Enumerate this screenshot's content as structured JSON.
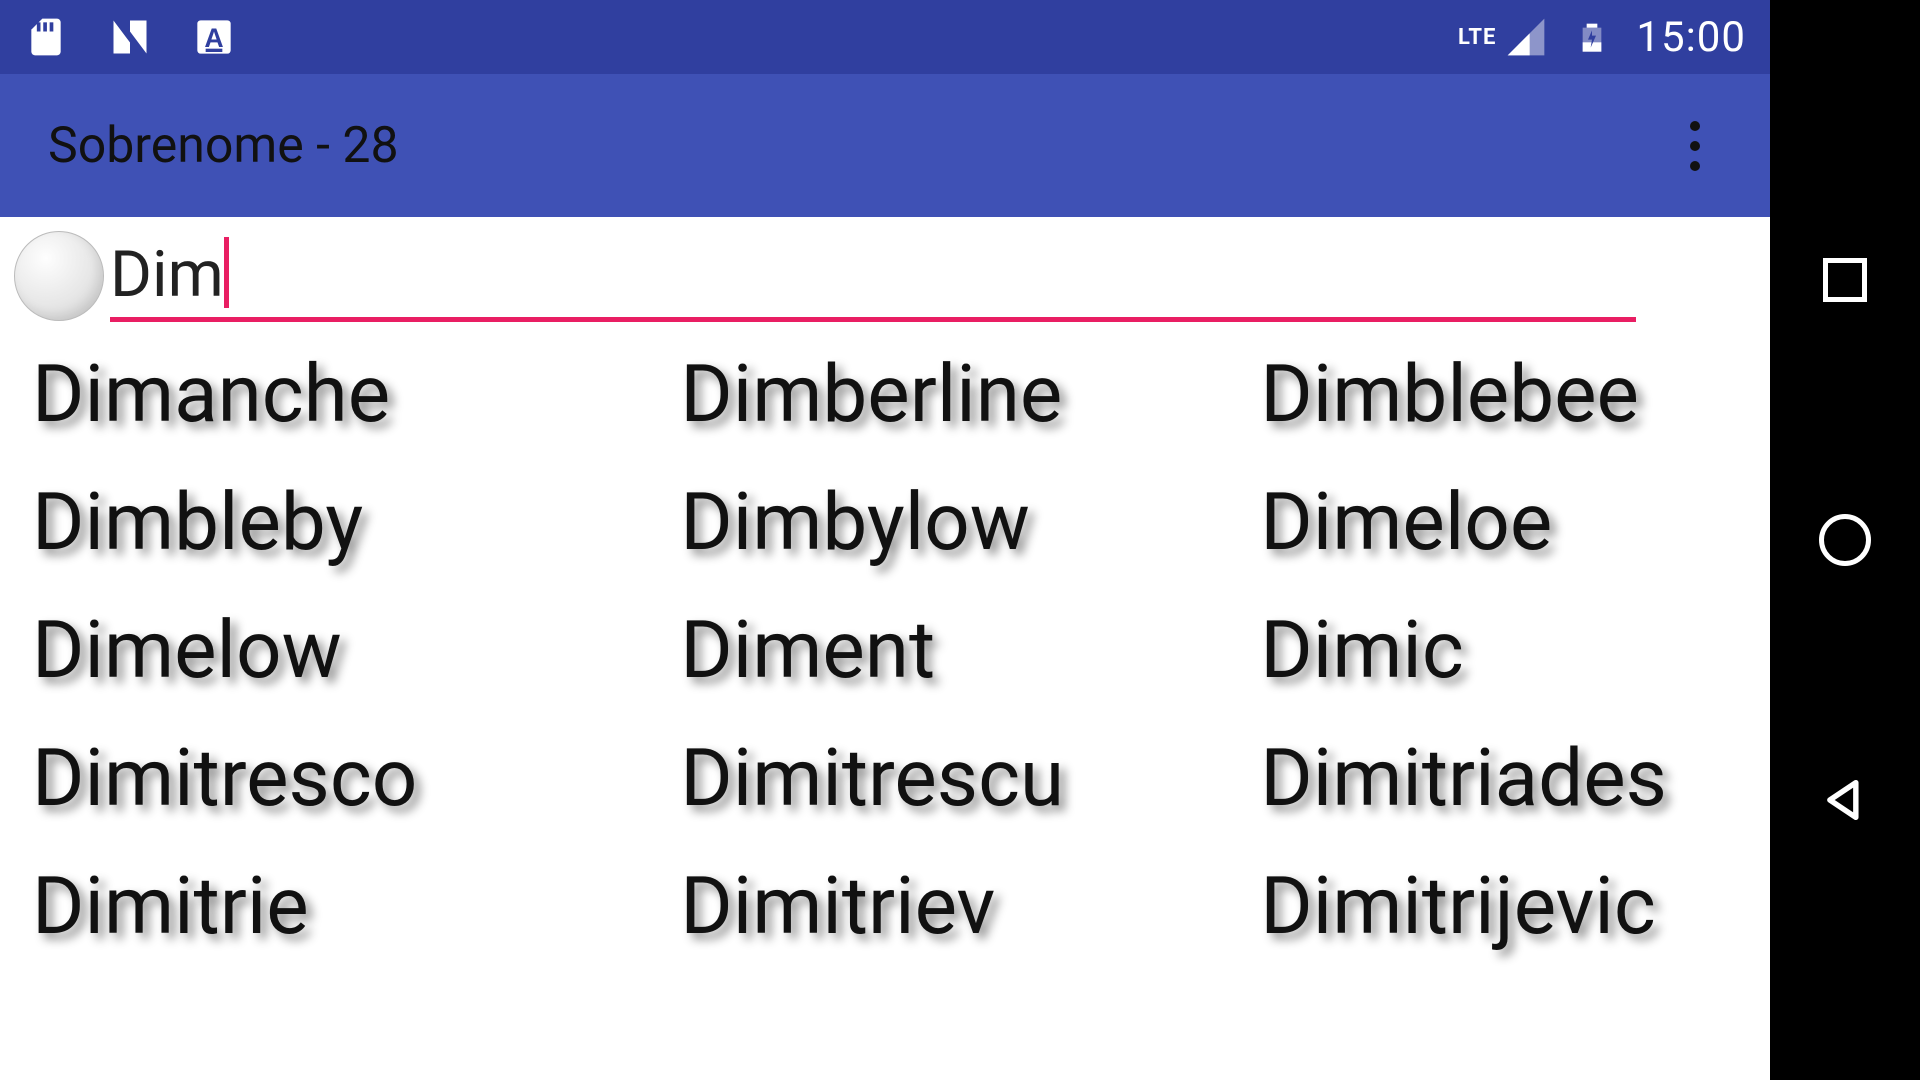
{
  "status_bar": {
    "time": "15:00",
    "lte_label": "LTE",
    "icons": {
      "sd": "sd-card-icon",
      "n": "n-app-icon",
      "a": "a-app-icon",
      "signal": "cell-signal-icon",
      "battery": "battery-icon"
    }
  },
  "app_bar": {
    "title": "Sobrenome - 28"
  },
  "search": {
    "value": "Dim",
    "caret_after": "Dim"
  },
  "results": [
    "Dimanche",
    "Dimberline",
    "Dimblebee",
    "Dimbleby",
    "Dimbylow",
    "Dimeloe",
    "Dimelow",
    "Diment",
    "Dimic",
    "Dimitresco",
    "Dimitrescu",
    "Dimitriades",
    "Dimitrie",
    "Dimitriev",
    "Dimitrijevic"
  ],
  "colors": {
    "status_bar": "#303f9f",
    "app_bar": "#3f51b5",
    "accent": "#e91e63"
  }
}
